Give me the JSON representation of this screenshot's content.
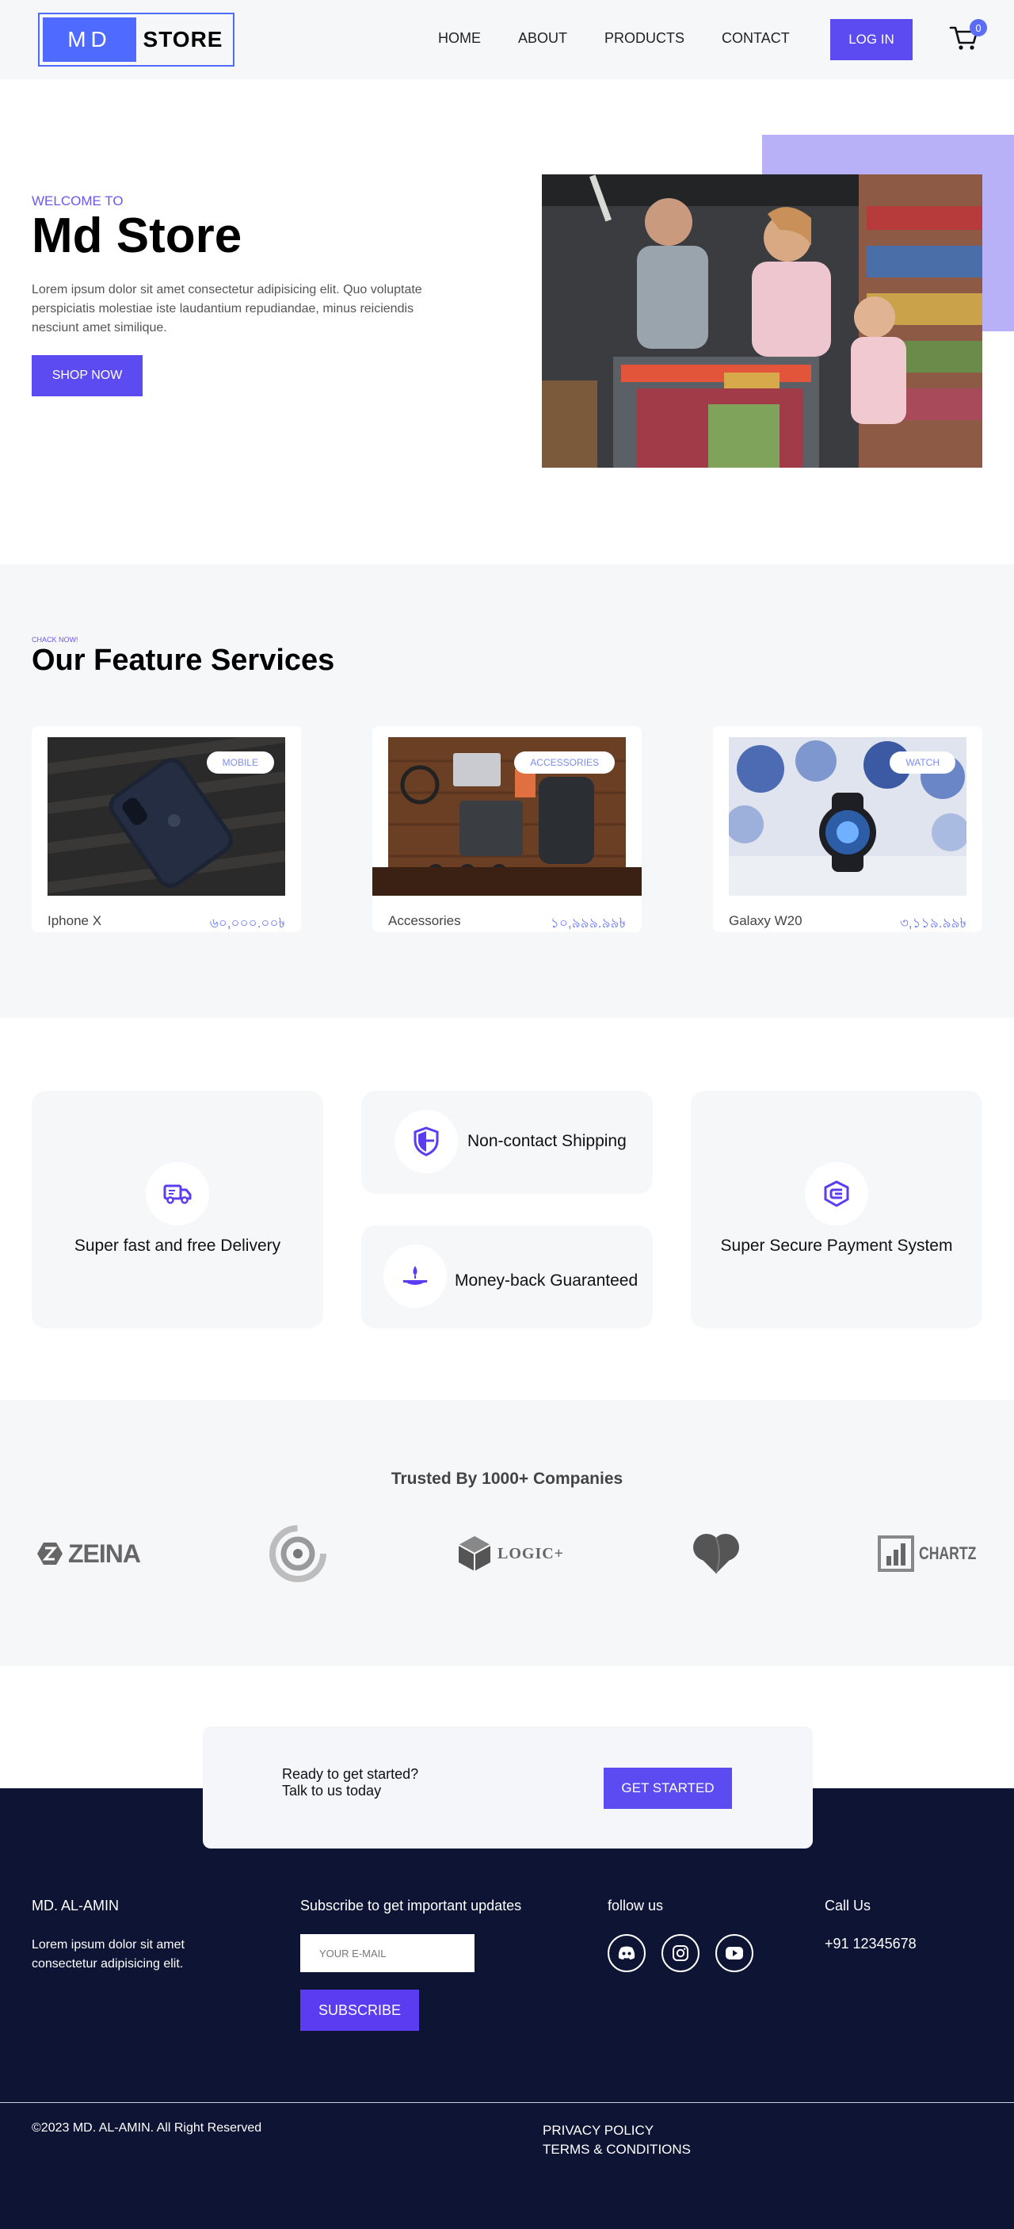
{
  "nav": {
    "logo_md": "MD",
    "logo_store": "STORE",
    "links": [
      "HOME",
      "ABOUT",
      "PRODUCTS",
      "CONTACT"
    ],
    "login_label": "LOG IN",
    "cart_count": "0",
    "cart_icon": "cart-icon"
  },
  "hero": {
    "welcome": "WELCOME TO",
    "title": "Md Store",
    "text": "Lorem ipsum dolor sit amet consectetur adipisicing elit. Quo voluptate perspiciatis molestiae iste laudantium repudiandae, minus reiciendis nesciunt amet similique.",
    "shop_label": "SHOP NOW",
    "accent_color": "#b8b1f7"
  },
  "features": {
    "subtitle": "CHACK NOW!",
    "title": "Our Feature Services",
    "products": [
      {
        "tag": "MOBILE",
        "name": "Iphone X",
        "price": "৬০,০০০.০০৳"
      },
      {
        "tag": "ACCESSORIES",
        "name": "Accessories",
        "price": "১০,৯৯৯.৯৯৳"
      },
      {
        "tag": "WATCH",
        "name": "Galaxy W20",
        "price": "৩,১১৯.৯৯৳"
      }
    ]
  },
  "benefits": {
    "delivery": {
      "label": "Super fast and free Delivery",
      "icon": "truck-icon"
    },
    "shipping": {
      "label": "Non-contact Shipping",
      "icon": "shield-icon"
    },
    "moneyback": {
      "label": "Money-back Guaranteed",
      "icon": "hand-coin-icon"
    },
    "payment": {
      "label": "Super Secure Payment System",
      "icon": "secure-payment-icon"
    }
  },
  "trusted": {
    "title": "Trusted By 1000+ Companies",
    "brands": [
      "ZEINA",
      "LOGIC+",
      "CHARTZ"
    ]
  },
  "cta": {
    "line1": "Ready to get started?",
    "line2": "Talk to us today",
    "button": "GET STARTED"
  },
  "footer": {
    "brand": "MD. AL-AMIN",
    "brand_text": "Lorem ipsum dolor sit amet consectetur adipisicing elit.",
    "subscribe_title": "Subscribe to get important updates",
    "email_placeholder": "YOUR E-MAIL",
    "subscribe_button": "SUBSCRIBE",
    "follow_title": "follow us",
    "call_title": "Call Us",
    "phone": "+91 12345678",
    "copyright": "©2023 MD. AL-AMIN. All Right Reserved",
    "privacy": "PRIVACY POLICY",
    "terms": "TERMS & CONDITIONS"
  },
  "colors": {
    "accent": "#5b4bf0",
    "logo_blue": "#4f6bff",
    "footer_bg": "#0e1433",
    "section_bg": "#f6f7f9"
  }
}
